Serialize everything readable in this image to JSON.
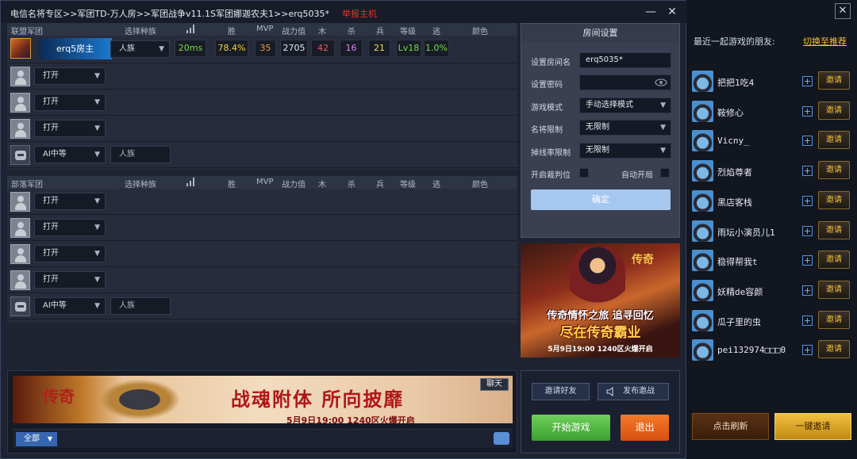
{
  "title": {
    "text": "电信名将专区>>军团TD-万人房>>军团战争v11.1S军团娜迦农夫1>>erq5035*",
    "report": "举报主机",
    "minimize": "—",
    "close": "✕"
  },
  "header_cols": {
    "race": "选择种族",
    "win": "胜",
    "mvp": "MVP",
    "power": "战力值",
    "wood": "木",
    "kill": "杀",
    "soldier": "兵",
    "level": "等级",
    "escape": "逃",
    "color": "颜色"
  },
  "alliance": {
    "name": "联盟军团",
    "host": {
      "name": "erq5房主",
      "race": "人族",
      "ping": "20ms",
      "win": "78.4%",
      "mvp": "35",
      "power": "2705",
      "wood": "42",
      "kill": "16",
      "soldier": "21",
      "level": "Lv18",
      "escape": "1.0%"
    },
    "slots": [
      "打开",
      "打开",
      "打开"
    ],
    "ai": {
      "level": "AI中等",
      "race": "人族"
    }
  },
  "horde": {
    "name": "部落军团",
    "slots": [
      "打开",
      "打开",
      "打开",
      "打开"
    ],
    "ai": {
      "level": "AI中等",
      "race": "人族"
    }
  },
  "room": {
    "title": "房间设置",
    "name_label": "设置房间名",
    "name_value": "erq5035*",
    "password_label": "设置密码",
    "mode_label": "游戏模式",
    "mode_value": "手动选择模式",
    "general_label": "名将限制",
    "general_value": "无限制",
    "drop_label": "掉线率限制",
    "drop_value": "无限制",
    "referee_label": "开启裁判位",
    "autostart_label": "自动开局",
    "confirm": "确定"
  },
  "ad_right": {
    "logo": "传奇",
    "line1": "传奇情怀之旅 追寻回忆",
    "line2": "尽在传奇霸业",
    "line3": "5月9日19:00  1240区火爆开启"
  },
  "ad_bottom": {
    "logo": "传奇",
    "slogan": "战魂附体  所向披靡",
    "sub": "5月9日19:00  1240区火爆开启"
  },
  "chat": {
    "tab": "聊天",
    "scope": "全部"
  },
  "actions": {
    "invite_friends": "邀请好友",
    "broadcast": "发布邀战",
    "start": "开始游戏",
    "exit": "退出"
  },
  "friends": {
    "header": "最近一起游戏的朋友:",
    "switch": "切换至推荐",
    "close": "✕",
    "invite_label": "邀请",
    "list": [
      "把把1吃4",
      "鞍修心",
      "Vicny_",
      "烈焰尊者",
      "黑店客栈",
      "雨坛小演员儿1",
      "稳得帮我t",
      "妖精de容颜",
      "瓜子里的虫",
      "pei132974□□□0"
    ],
    "refresh": "点击刷新",
    "invite_all": "一键邀请"
  }
}
